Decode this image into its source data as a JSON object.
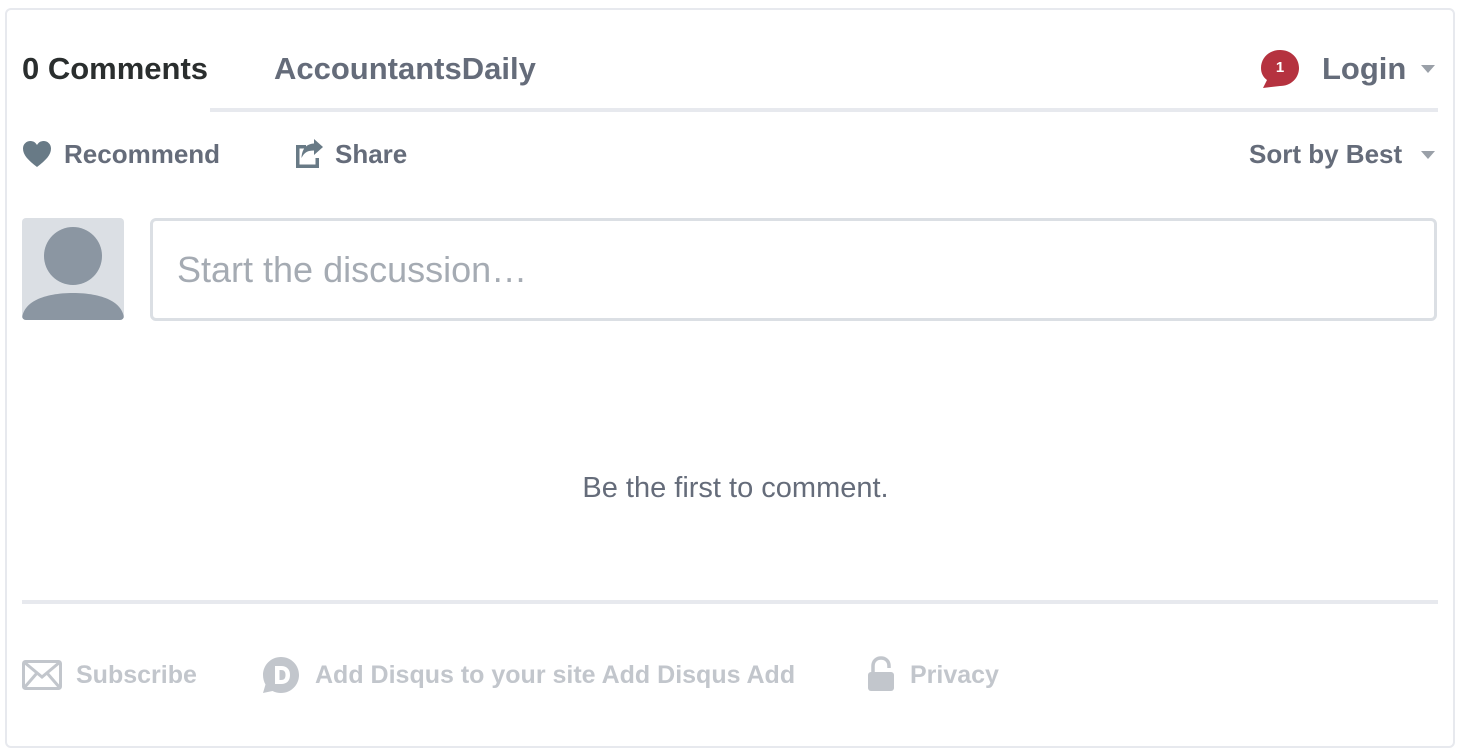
{
  "header": {
    "comment_count_tab": "0 Comments",
    "forum_tab": "AccountantsDaily",
    "notification_count": "1",
    "login_label": "Login"
  },
  "actions": {
    "recommend_label": "Recommend",
    "share_label": "Share",
    "sort_label": "Sort by Best"
  },
  "composer": {
    "placeholder": "Start the discussion…"
  },
  "empty_state": {
    "message": "Be the first to comment."
  },
  "footer": {
    "subscribe_label": "Subscribe",
    "add_disqus_label": "Add Disqus to your site Add Disqus Add",
    "privacy_label": "Privacy"
  },
  "icons": {
    "notification": "speech-bubble-icon",
    "recommend": "heart-icon",
    "share": "share-icon",
    "subscribe": "envelope-icon",
    "add_disqus": "disqus-logo-icon",
    "privacy": "lock-icon",
    "dropdown": "caret-down-icon"
  },
  "colors": {
    "primary_text": "#2a2e2e",
    "secondary_text": "#656c7a",
    "muted_text": "#c2c6cc",
    "notification_badge": "#b5323f",
    "divider": "#e7e9ee"
  }
}
